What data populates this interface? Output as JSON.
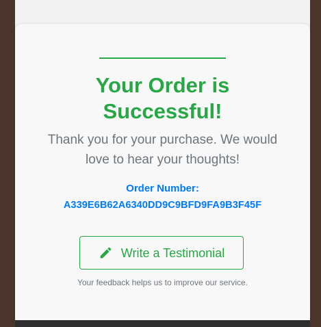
{
  "success_card": {
    "title_line1": "Your Order is",
    "title_line2": "Successful!",
    "message": "Thank you for your purchase. We would love to hear your thoughts!",
    "order_label": "Order Number:",
    "order_number": "A339E6B62A6340DD9C9BFD9FA9B3F45F",
    "testimonial_button": {
      "label": "Write a Testimonial",
      "icon": "pencil-icon"
    },
    "feedback_note": "Your feedback helps us to improve our service."
  },
  "colors": {
    "accent_green": "#28a745",
    "link_blue": "#007bff",
    "muted_text": "#6c757d",
    "page_background": "#4a342b",
    "card_background": "#f8f8f8"
  }
}
